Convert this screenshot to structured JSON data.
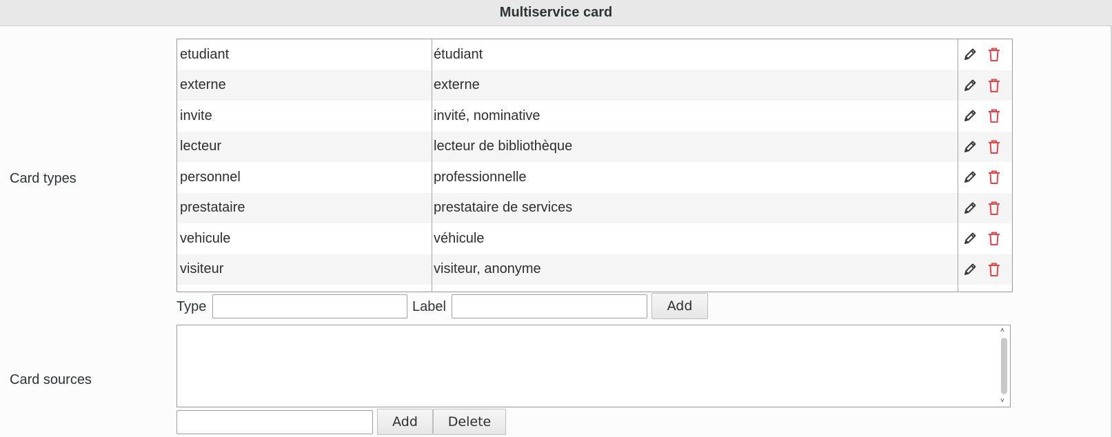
{
  "header": {
    "title": "Multiservice card"
  },
  "card_types": {
    "label": "Card types",
    "rows": [
      {
        "type": "etudiant",
        "label": "étudiant"
      },
      {
        "type": "externe",
        "label": "externe"
      },
      {
        "type": "invite",
        "label": "invité, nominative"
      },
      {
        "type": "lecteur",
        "label": "lecteur de bibliothèque"
      },
      {
        "type": "personnel",
        "label": "professionnelle"
      },
      {
        "type": "prestataire",
        "label": "prestataire de services"
      },
      {
        "type": "vehicule",
        "label": "véhicule"
      },
      {
        "type": "visiteur",
        "label": "visiteur, anonyme"
      }
    ],
    "form": {
      "type_label": "Type",
      "type_value": "",
      "label_label": "Label",
      "label_value": "",
      "add_label": "Add"
    }
  },
  "card_sources": {
    "label": "Card sources",
    "items": [],
    "input_value": "",
    "add_label": "Add",
    "delete_label": "Delete"
  },
  "icons": {
    "edit": "pencil-icon",
    "delete": "trash-icon"
  },
  "colors": {
    "delete_icon": "#e0474c",
    "edit_icon": "#3a3a3a"
  }
}
